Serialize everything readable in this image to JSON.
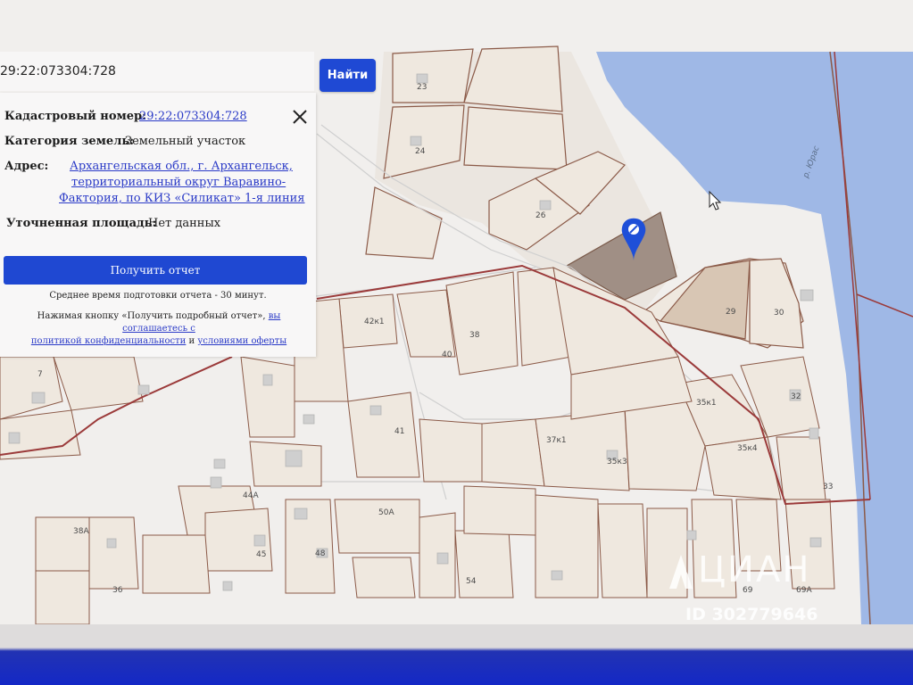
{
  "search": {
    "value": "29:22:073304:728",
    "button_label": "Найти"
  },
  "card": {
    "cadastral_label": "Кадастровый номер:",
    "cadastral_value": "29:22:073304:728",
    "category_label": "Категория земель:",
    "category_value": "Земельный участок",
    "address_label": "Адрес:",
    "address_lines": [
      "Архангельская обл., г. Архангельск,",
      "территориальный округ Варавино-",
      "Фактория, по КИЗ «Силикат» 1-я линия"
    ],
    "area_label": "Уточненная площадь:",
    "area_value": "Нет данных",
    "report_button": "Получить отчет",
    "avg_time": "Среднее время подготовки отчета - 30 минут.",
    "consent_prefix": "Нажимая кнопку «Получить подробный отчет»,",
    "consent_link": "вы соглашаетесь с",
    "privacy_link": "политикой конфиденциальности",
    "consent_and": "и",
    "terms_link": "условиями оферты"
  },
  "map": {
    "river_label": "р. Юрас",
    "plot_labels": [
      "23",
      "24",
      "26",
      "29",
      "30",
      "42к1",
      "38",
      "40",
      "32",
      "35к1",
      "35к4",
      "41",
      "37к1",
      "35к3",
      "33",
      "7",
      "44А",
      "50А",
      "38А",
      "45",
      "48",
      "54",
      "36",
      "69",
      "69А"
    ],
    "colors": {
      "water": "#9fb8e6",
      "selected_plot": "#a08f85",
      "boundary": "#9b3a3a",
      "parcel_line": "#8b5a48"
    }
  },
  "watermark": {
    "brand": "ЦИАН",
    "id": "ID 302779646"
  },
  "marker": {
    "icon": "map-pin-icon",
    "color": "#1e4fd8"
  },
  "close_icon": "close-icon"
}
